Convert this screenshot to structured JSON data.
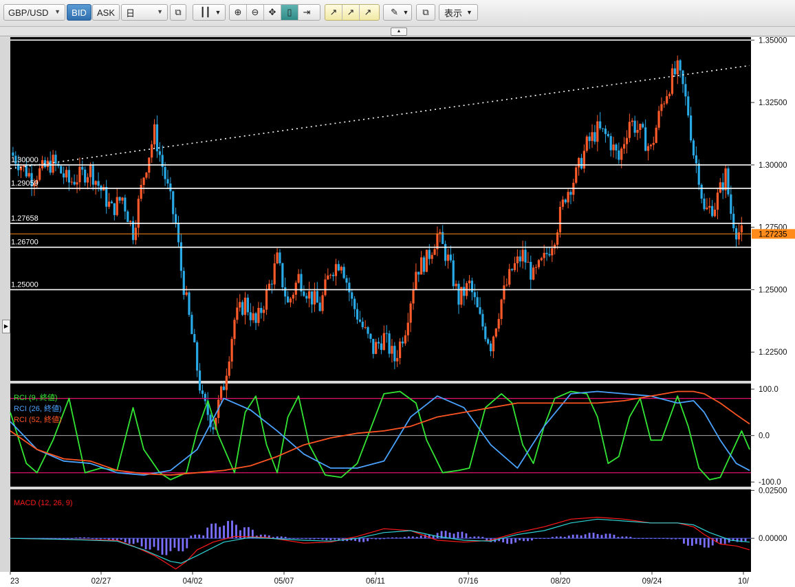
{
  "toolbar": {
    "symbol": "GBP/USD",
    "bid_label": "BID",
    "ask_label": "ASK",
    "timeframe": "日",
    "display_label": "表示",
    "icons": [
      "compare-icon",
      "candlestick-icon",
      "zoom-in-icon",
      "zoom-out-icon",
      "fit-icon",
      "panel-icon",
      "scroll-end-icon",
      "indicator-add-icon",
      "indicator-list-icon",
      "indicator-settings-icon",
      "draw-pencil-icon",
      "popout-icon"
    ]
  },
  "colors": {
    "up_candle": "#ff5a2a",
    "down_candle": "#29a9e5",
    "level_line": "#ffffff",
    "current_price_tag": "#ff8c1a",
    "rci_short": "#33e633",
    "rci_mid": "#4aa3ff",
    "rci_long": "#ff5522",
    "rci_bounds": "#e0106c",
    "macd_line": "#ff1a1a",
    "macd_signal": "#2ed4d4",
    "macd_hist": "#7b70ff"
  },
  "chart_data": [
    {
      "type": "candlestick",
      "instrument": "GBP/USD",
      "x_ticks": [
        "23",
        "02/27",
        "04/02",
        "05/07",
        "06/11",
        "07/16",
        "08/20",
        "09/24",
        "10/"
      ],
      "y_ticks": [
        "1.35000",
        "1.32500",
        "1.30000",
        "1.27500",
        "1.25000",
        "1.22500"
      ],
      "ylim": [
        1.2135,
        1.3512
      ],
      "top_tick_partial": "1.35551",
      "current_price": "1.27235",
      "levels": [
        {
          "value": 1.35,
          "label": ""
        },
        {
          "value": 1.3,
          "label": "1.30000"
        },
        {
          "value": 1.29059,
          "label": "1.29059"
        },
        {
          "value": 1.27658,
          "label": "1.27658"
        },
        {
          "value": 1.267,
          "label": "1.26700"
        },
        {
          "value": 1.25,
          "label": "1.25000"
        }
      ],
      "trendline": {
        "style": "dotted",
        "from": [
          0,
          1.2985
        ],
        "to": [
          277,
          1.3398
        ]
      },
      "close_path": [
        [
          0,
          1.305
        ],
        [
          8,
          1.295
        ],
        [
          16,
          1.301
        ],
        [
          22,
          1.293
        ],
        [
          30,
          1.298
        ],
        [
          38,
          1.282
        ],
        [
          42,
          1.287
        ],
        [
          46,
          1.273
        ],
        [
          50,
          1.296
        ],
        [
          54,
          1.313
        ],
        [
          58,
          1.295
        ],
        [
          62,
          1.276
        ],
        [
          64,
          1.258
        ],
        [
          68,
          1.232
        ],
        [
          72,
          1.205
        ],
        [
          76,
          1.196
        ],
        [
          80,
          1.212
        ],
        [
          84,
          1.238
        ],
        [
          88,
          1.245
        ],
        [
          92,
          1.236
        ],
        [
          96,
          1.248
        ],
        [
          100,
          1.262
        ],
        [
          104,
          1.244
        ],
        [
          108,
          1.255
        ],
        [
          112,
          1.248
        ],
        [
          116,
          1.243
        ],
        [
          120,
          1.258
        ],
        [
          124,
          1.262
        ],
        [
          128,
          1.245
        ],
        [
          132,
          1.235
        ],
        [
          136,
          1.226
        ],
        [
          140,
          1.231
        ],
        [
          144,
          1.222
        ],
        [
          148,
          1.235
        ],
        [
          152,
          1.258
        ],
        [
          156,
          1.262
        ],
        [
          160,
          1.272
        ],
        [
          164,
          1.262
        ],
        [
          168,
          1.246
        ],
        [
          172,
          1.252
        ],
        [
          176,
          1.238
        ],
        [
          180,
          1.228
        ],
        [
          184,
          1.246
        ],
        [
          188,
          1.258
        ],
        [
          192,
          1.264
        ],
        [
          196,
          1.255
        ],
        [
          200,
          1.262
        ],
        [
          204,
          1.272
        ],
        [
          208,
          1.288
        ],
        [
          212,
          1.296
        ],
        [
          216,
          1.308
        ],
        [
          220,
          1.314
        ],
        [
          224,
          1.311
        ],
        [
          228,
          1.302
        ],
        [
          232,
          1.318
        ],
        [
          236,
          1.313
        ],
        [
          240,
          1.306
        ],
        [
          244,
          1.324
        ],
        [
          248,
          1.335
        ],
        [
          250,
          1.338
        ],
        [
          252,
          1.331
        ],
        [
          254,
          1.321
        ],
        [
          256,
          1.305
        ],
        [
          258,
          1.296
        ],
        [
          260,
          1.281
        ],
        [
          264,
          1.284
        ],
        [
          268,
          1.296
        ],
        [
          270,
          1.281
        ],
        [
          272,
          1.274
        ],
        [
          274,
          1.2723
        ]
      ]
    },
    {
      "type": "line",
      "title": "RCI",
      "legend": [
        "RCI (9, 終値)",
        "RCI (26, 終値)",
        "RCI (52, 終値)"
      ],
      "y_ticks": [
        "100.0",
        "0.0",
        "-100.0"
      ],
      "ylim": [
        -110,
        112
      ],
      "bounds": [
        80,
        -80
      ],
      "series": [
        {
          "name": "RCI (9, 終値)",
          "points": [
            [
              0,
              50
            ],
            [
              6,
              -60
            ],
            [
              10,
              -80
            ],
            [
              16,
              -10
            ],
            [
              22,
              80
            ],
            [
              28,
              -80
            ],
            [
              34,
              -70
            ],
            [
              40,
              -75
            ],
            [
              46,
              60
            ],
            [
              50,
              -30
            ],
            [
              56,
              -80
            ],
            [
              60,
              -95
            ],
            [
              66,
              -80
            ],
            [
              70,
              10
            ],
            [
              74,
              75
            ],
            [
              78,
              0
            ],
            [
              84,
              -80
            ],
            [
              88,
              50
            ],
            [
              92,
              85
            ],
            [
              96,
              -20
            ],
            [
              100,
              -80
            ],
            [
              104,
              40
            ],
            [
              108,
              85
            ],
            [
              112,
              -20
            ],
            [
              118,
              -85
            ],
            [
              124,
              -90
            ],
            [
              130,
              -60
            ],
            [
              136,
              30
            ],
            [
              140,
              90
            ],
            [
              146,
              95
            ],
            [
              152,
              70
            ],
            [
              156,
              -10
            ],
            [
              162,
              -80
            ],
            [
              168,
              -75
            ],
            [
              172,
              -70
            ],
            [
              178,
              60
            ],
            [
              184,
              90
            ],
            [
              188,
              70
            ],
            [
              192,
              -20
            ],
            [
              196,
              -60
            ],
            [
              200,
              20
            ],
            [
              204,
              80
            ],
            [
              210,
              95
            ],
            [
              216,
              90
            ],
            [
              220,
              40
            ],
            [
              224,
              -60
            ],
            [
              228,
              -45
            ],
            [
              232,
              40
            ],
            [
              236,
              80
            ],
            [
              240,
              -10
            ],
            [
              244,
              -10
            ],
            [
              250,
              85
            ],
            [
              254,
              20
            ],
            [
              258,
              -70
            ],
            [
              262,
              -95
            ],
            [
              266,
              -90
            ],
            [
              270,
              -40
            ],
            [
              274,
              10
            ],
            [
              277,
              -30
            ]
          ]
        },
        {
          "name": "RCI (26, 終値)",
          "points": [
            [
              0,
              30
            ],
            [
              10,
              -30
            ],
            [
              20,
              -55
            ],
            [
              30,
              -60
            ],
            [
              40,
              -80
            ],
            [
              50,
              -85
            ],
            [
              60,
              -75
            ],
            [
              70,
              -30
            ],
            [
              80,
              80
            ],
            [
              90,
              55
            ],
            [
              100,
              10
            ],
            [
              110,
              -40
            ],
            [
              120,
              -70
            ],
            [
              130,
              -70
            ],
            [
              140,
              -55
            ],
            [
              150,
              40
            ],
            [
              160,
              85
            ],
            [
              170,
              60
            ],
            [
              180,
              -20
            ],
            [
              190,
              -70
            ],
            [
              200,
              20
            ],
            [
              210,
              90
            ],
            [
              220,
              95
            ],
            [
              230,
              90
            ],
            [
              240,
              85
            ],
            [
              250,
              70
            ],
            [
              256,
              75
            ],
            [
              260,
              50
            ],
            [
              266,
              -10
            ],
            [
              272,
              -60
            ],
            [
              277,
              -75
            ]
          ]
        },
        {
          "name": "RCI (52, 終値)",
          "points": [
            [
              0,
              10
            ],
            [
              10,
              -30
            ],
            [
              20,
              -50
            ],
            [
              30,
              -55
            ],
            [
              40,
              -75
            ],
            [
              50,
              -82
            ],
            [
              60,
              -85
            ],
            [
              70,
              -80
            ],
            [
              80,
              -75
            ],
            [
              90,
              -65
            ],
            [
              100,
              -45
            ],
            [
              110,
              -20
            ],
            [
              120,
              -5
            ],
            [
              130,
              5
            ],
            [
              140,
              10
            ],
            [
              150,
              20
            ],
            [
              160,
              40
            ],
            [
              170,
              50
            ],
            [
              180,
              60
            ],
            [
              190,
              70
            ],
            [
              200,
              70
            ],
            [
              210,
              70
            ],
            [
              220,
              70
            ],
            [
              230,
              75
            ],
            [
              240,
              85
            ],
            [
              250,
              95
            ],
            [
              256,
              95
            ],
            [
              260,
              90
            ],
            [
              266,
              70
            ],
            [
              272,
              45
            ],
            [
              277,
              25
            ]
          ]
        }
      ]
    },
    {
      "type": "line",
      "title": "MACD",
      "legend": [
        "MACD (12, 26, 9)"
      ],
      "y_ticks": [
        "0.02500",
        "0.00000"
      ],
      "ylim": [
        -0.0175,
        0.0255
      ],
      "top_tick_partial": "0.02500",
      "series": [
        {
          "name": "MACD",
          "points": [
            [
              0,
              0
            ],
            [
              20,
              -0.0005
            ],
            [
              40,
              -0.001
            ],
            [
              46,
              -0.004
            ],
            [
              54,
              -0.009
            ],
            [
              62,
              -0.016
            ],
            [
              66,
              -0.012
            ],
            [
              70,
              -0.006
            ],
            [
              76,
              -0.002
            ],
            [
              84,
              0.001
            ],
            [
              96,
              0.0005
            ],
            [
              110,
              -0.0025
            ],
            [
              120,
              -0.002
            ],
            [
              130,
              0.001
            ],
            [
              140,
              0.005
            ],
            [
              150,
              0.004
            ],
            [
              160,
              -0.001
            ],
            [
              170,
              -0.002
            ],
            [
              180,
              -0.001
            ],
            [
              190,
              0.003
            ],
            [
              200,
              0.006
            ],
            [
              210,
              0.01
            ],
            [
              220,
              0.011
            ],
            [
              230,
              0.01
            ],
            [
              240,
              0.008
            ],
            [
              250,
              0.008
            ],
            [
              256,
              0.006
            ],
            [
              260,
              0.002
            ],
            [
              266,
              -0.003
            ],
            [
              272,
              -0.004
            ],
            [
              277,
              -0.006
            ]
          ]
        },
        {
          "name": "Signal",
          "points": [
            [
              0,
              0
            ],
            [
              20,
              -0.0005
            ],
            [
              40,
              -0.0015
            ],
            [
              50,
              -0.006
            ],
            [
              60,
              -0.012
            ],
            [
              64,
              -0.013
            ],
            [
              70,
              -0.009
            ],
            [
              80,
              -0.002
            ],
            [
              90,
              0.0005
            ],
            [
              110,
              -0.001
            ],
            [
              120,
              -0.0015
            ],
            [
              130,
              0
            ],
            [
              140,
              0.003
            ],
            [
              150,
              0.004
            ],
            [
              160,
              0.001
            ],
            [
              170,
              -0.001
            ],
            [
              180,
              -0.0015
            ],
            [
              190,
              0.002
            ],
            [
              200,
              0.004
            ],
            [
              210,
              0.008
            ],
            [
              220,
              0.01
            ],
            [
              230,
              0.009
            ],
            [
              240,
              0.008
            ],
            [
              250,
              0.008
            ],
            [
              256,
              0.007
            ],
            [
              262,
              0.003
            ],
            [
              270,
              -0.001
            ],
            [
              277,
              -0.002
            ]
          ]
        }
      ],
      "histogram": [
        0,
        0,
        -0.0005,
        0,
        0.0005,
        -0.0005,
        -0.001,
        -0.003,
        -0.006,
        -0.009,
        -0.007,
        0.002,
        0.008,
        0.0095,
        0.006,
        0.002,
        0.001,
        0,
        -0.0005,
        -0.001,
        -0.0015,
        -0.002,
        -0.0005,
        0.0005,
        0.001,
        0.002,
        0.004,
        0.0035,
        0.001,
        -0.002,
        -0.003,
        -0.0015,
        0,
        0.001,
        0.002,
        0.003,
        0.0025,
        0.001,
        0,
        0,
        -0.0005,
        -0.004,
        -0.005,
        -0.003,
        -0.002
      ]
    }
  ]
}
